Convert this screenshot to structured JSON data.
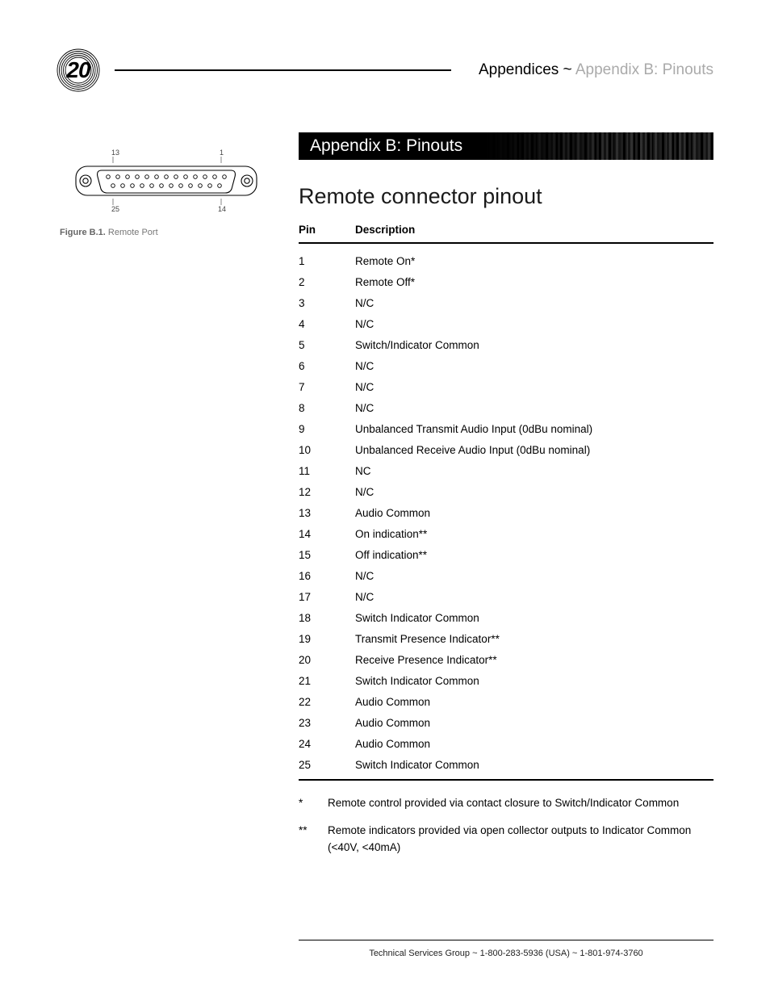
{
  "page_number": "20",
  "breadcrumb": {
    "section": "Appendices",
    "sep": " ~ ",
    "page": "Appendix B: Pinouts"
  },
  "banner": "Appendix B: Pinouts",
  "section_title": "Remote connector pinout",
  "figure": {
    "pin_tl": "13",
    "pin_tr": "1",
    "pin_bl": "25",
    "pin_br": "14",
    "caption_bold": "Figure B.1.",
    "caption_rest": " Remote Port"
  },
  "table": {
    "headers": {
      "pin": "Pin",
      "desc": "Description"
    },
    "rows": [
      {
        "pin": "1",
        "desc": "Remote On*"
      },
      {
        "pin": "2",
        "desc": "Remote Off*"
      },
      {
        "pin": "3",
        "desc": "N/C"
      },
      {
        "pin": "4",
        "desc": "N/C"
      },
      {
        "pin": "5",
        "desc": "Switch/Indicator Common"
      },
      {
        "pin": "6",
        "desc": "N/C"
      },
      {
        "pin": "7",
        "desc": "N/C"
      },
      {
        "pin": "8",
        "desc": "N/C"
      },
      {
        "pin": "9",
        "desc": "Unbalanced Transmit Audio Input (0dBu nominal)"
      },
      {
        "pin": "10",
        "desc": "Unbalanced Receive Audio Input (0dBu nominal)"
      },
      {
        "pin": "11",
        "desc": "NC"
      },
      {
        "pin": "12",
        "desc": "N/C"
      },
      {
        "pin": "13",
        "desc": "Audio Common"
      },
      {
        "pin": "14",
        "desc": "On indication**"
      },
      {
        "pin": "15",
        "desc": "Off indication**"
      },
      {
        "pin": "16",
        "desc": "N/C"
      },
      {
        "pin": "17",
        "desc": "N/C"
      },
      {
        "pin": "18",
        "desc": "Switch Indicator Common"
      },
      {
        "pin": "19",
        "desc": "Transmit Presence Indicator**"
      },
      {
        "pin": "20",
        "desc": "Receive Presence Indicator**"
      },
      {
        "pin": "21",
        "desc": "Switch Indicator Common"
      },
      {
        "pin": "22",
        "desc": "Audio Common"
      },
      {
        "pin": "23",
        "desc": "Audio Common"
      },
      {
        "pin": "24",
        "desc": "Audio Common"
      },
      {
        "pin": "25",
        "desc": "Switch Indicator Common"
      }
    ]
  },
  "footnotes": [
    {
      "mark": "*",
      "text": "Remote control provided via contact closure to Switch/Indicator Common"
    },
    {
      "mark": "**",
      "text": "Remote indicators provided via open collector outputs to Indicator Common (<40V, <40mA)"
    }
  ],
  "footer": "Technical Services Group ~ 1-800-283-5936 (USA) ~ 1-801-974-3760"
}
